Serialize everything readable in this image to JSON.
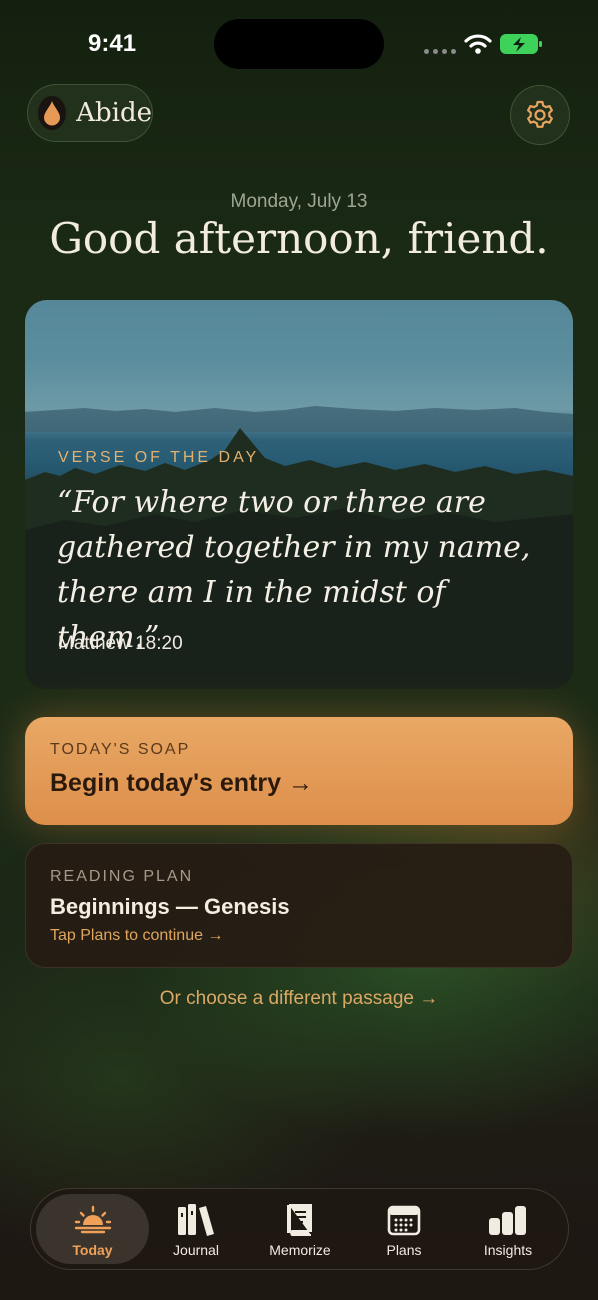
{
  "status_bar": {
    "time": "9:41"
  },
  "header": {
    "brand_name": "Abide",
    "icons": {
      "brand": "water-drop-icon",
      "settings": "gear-icon"
    }
  },
  "greeting": {
    "date": "Monday, July 13",
    "message": "Good afternoon, friend."
  },
  "verse_of_day": {
    "label": "VERSE OF THE DAY",
    "text": "“For where two or three are gathered together in my name, there am I in the midst of them.”",
    "reference": "Matthew 18:20"
  },
  "soap_card": {
    "label": "TODAY'S SOAP",
    "title": "Begin today's entry →"
  },
  "reading_plan": {
    "label": "READING PLAN",
    "title": "Beginnings — Genesis",
    "hint": "Tap Plans to continue →"
  },
  "alt_link": "Or choose a different passage →",
  "tab_bar": {
    "active": "Today",
    "tabs": [
      {
        "label": "Today",
        "icon": "sunrise-icon"
      },
      {
        "label": "Journal",
        "icon": "books-icon"
      },
      {
        "label": "Memorize",
        "icon": "book-icon"
      },
      {
        "label": "Plans",
        "icon": "calendar-icon"
      },
      {
        "label": "Insights",
        "icon": "bar-chart-icon"
      }
    ]
  },
  "colors": {
    "accent": "#e3a260",
    "active_tab_label": "#f1a05a",
    "background": "#1b2b16"
  }
}
